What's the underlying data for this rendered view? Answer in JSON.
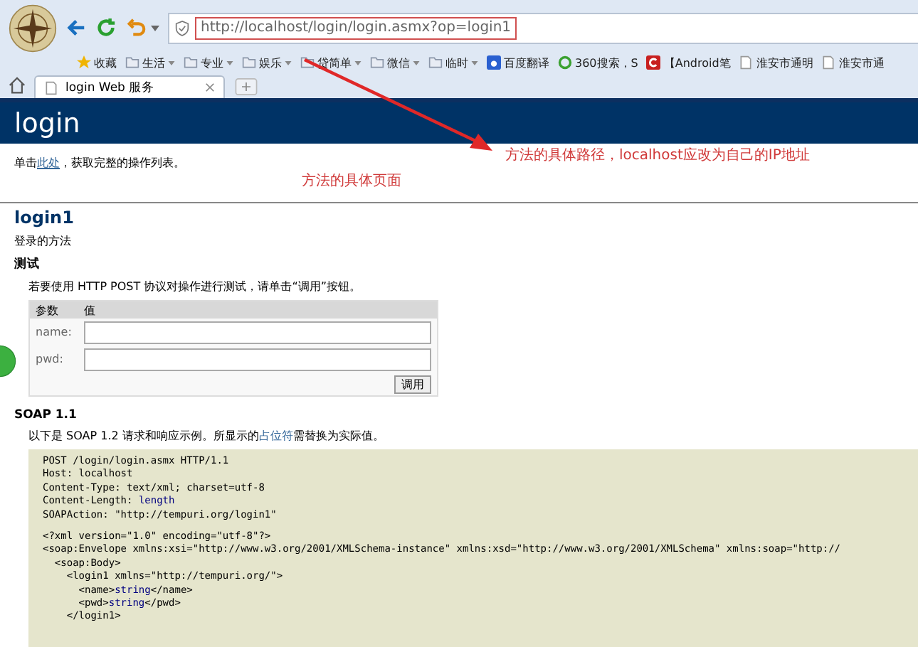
{
  "browser": {
    "url": "http://localhost/login/login.asmx?op=login1",
    "bookmarks": [
      {
        "kind": "star",
        "label": "收藏",
        "dropdown": false
      },
      {
        "kind": "folder",
        "label": "生活",
        "dropdown": true
      },
      {
        "kind": "folder",
        "label": "专业",
        "dropdown": true
      },
      {
        "kind": "folder",
        "label": "娱乐",
        "dropdown": true
      },
      {
        "kind": "folder",
        "label": "贷简单",
        "dropdown": true
      },
      {
        "kind": "folder",
        "label": "微信",
        "dropdown": true
      },
      {
        "kind": "folder",
        "label": "临时",
        "dropdown": true
      },
      {
        "kind": "translate",
        "label": "百度翻译",
        "dropdown": false
      },
      {
        "kind": "search",
        "label": "360搜索，S",
        "dropdown": false
      },
      {
        "kind": "app",
        "label": "【Android笔",
        "dropdown": false
      },
      {
        "kind": "page",
        "label": "淮安市通明",
        "dropdown": false
      },
      {
        "kind": "page",
        "label": "淮安市通",
        "dropdown": false
      }
    ],
    "tabs": [
      {
        "title": "login Web 服务",
        "selected": true
      }
    ]
  },
  "page": {
    "heading": "login",
    "intro_before": "单击",
    "intro_link": "此处",
    "intro_after": "，获取完整的操作列表。",
    "method": "login1",
    "method_desc": "登录的方法",
    "test_heading": "测试",
    "test_intro": "若要使用 HTTP POST 协议对操作进行测试，请单击“调用”按钮。",
    "form": {
      "columns": [
        "参数",
        "值"
      ],
      "params": [
        {
          "label": "name:"
        },
        {
          "label": "pwd:"
        }
      ],
      "submit": "调用"
    },
    "soap_heading": "SOAP 1.1",
    "soap_before": "以下是 SOAP 1.2 请求和响应示例。所显示的",
    "soap_link": "占位符",
    "soap_after": "需替换为实际值。",
    "code_headers": [
      {
        "text": "POST /login/login.asmx HTTP/1.1"
      },
      {
        "text": "Host: localhost"
      },
      {
        "text": "Content-Type: text/xml; charset=utf-8"
      },
      {
        "text": "Content-Length: ",
        "placeholder": "length"
      },
      {
        "text": "SOAPAction: \"http://tempuri.org/login1\""
      }
    ],
    "code_body": [
      {
        "text": "<?xml version=\"1.0\" encoding=\"utf-8\"?>"
      },
      {
        "text": "<soap:Envelope xmlns:xsi=\"http://www.w3.org/2001/XMLSchema-instance\" xmlns:xsd=\"http://www.w3.org/2001/XMLSchema\" xmlns:soap=\"http://"
      },
      {
        "text": "  <soap:Body>"
      },
      {
        "text": "    <login1 xmlns=\"http://tempuri.org/\">"
      },
      {
        "text": "      <name>",
        "placeholder": "string",
        "after": "</name>"
      },
      {
        "text": "      <pwd>",
        "placeholder": "string",
        "after": "</pwd>"
      },
      {
        "text": "    </login1>"
      }
    ]
  },
  "annotations": [
    {
      "text": "方法的具体路径，localhost应改为自己的IP地址"
    },
    {
      "text": "方法的具体页面"
    }
  ]
}
